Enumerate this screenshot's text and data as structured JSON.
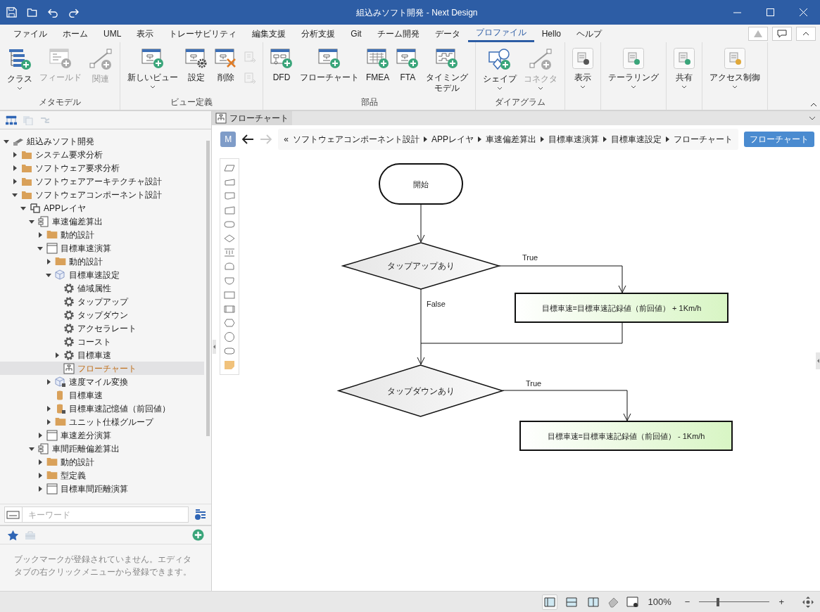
{
  "window": {
    "title": "組込みソフト開発 - Next Design"
  },
  "menu_tabs": [
    {
      "label": "ファイル",
      "selected": false
    },
    {
      "label": "ホーム",
      "selected": false
    },
    {
      "label": "UML",
      "selected": false
    },
    {
      "label": "表示",
      "selected": false
    },
    {
      "label": "トレーサビリティ",
      "selected": false
    },
    {
      "label": "編集支援",
      "selected": false
    },
    {
      "label": "分析支援",
      "selected": false
    },
    {
      "label": "Git",
      "selected": false
    },
    {
      "label": "チーム開発",
      "selected": false
    },
    {
      "label": "データ",
      "selected": false
    },
    {
      "label": "プロファイル",
      "selected": true
    },
    {
      "label": "Hello",
      "selected": false
    },
    {
      "label": "ヘルプ",
      "selected": false
    }
  ],
  "ribbon_groups": [
    {
      "label": "メタモデル",
      "buttons": [
        {
          "kind": "large",
          "label": "クラス",
          "dropdown": true,
          "disabled": false
        },
        {
          "kind": "large",
          "label": "フィールド",
          "dropdown": false,
          "disabled": true
        },
        {
          "kind": "large",
          "label": "関連",
          "dropdown": false,
          "disabled": true
        }
      ]
    },
    {
      "label": "ビュー定義",
      "buttons": [
        {
          "kind": "large",
          "label": "新しいビュー",
          "dropdown": true,
          "disabled": false
        },
        {
          "kind": "large",
          "label": "設定",
          "dropdown": false,
          "disabled": false
        },
        {
          "kind": "large",
          "label": "削除",
          "dropdown": false,
          "disabled": false
        },
        {
          "kind": "small",
          "disabled": true
        },
        {
          "kind": "small",
          "disabled": true
        }
      ]
    },
    {
      "label": "部品",
      "buttons": [
        {
          "kind": "large",
          "label": "DFD",
          "dropdown": false,
          "disabled": false
        },
        {
          "kind": "large",
          "label": "フローチャート",
          "dropdown": false,
          "disabled": false
        },
        {
          "kind": "large",
          "label": "FMEA",
          "dropdown": false,
          "disabled": false
        },
        {
          "kind": "large",
          "label": "FTA",
          "dropdown": false,
          "disabled": false
        },
        {
          "kind": "large",
          "label_lines": [
            "タイミング",
            "モデル"
          ],
          "dropdown": false,
          "disabled": false
        }
      ]
    },
    {
      "label": "ダイアグラム",
      "buttons": [
        {
          "kind": "large",
          "label": "シェイプ",
          "dropdown": true,
          "disabled": false
        },
        {
          "kind": "large",
          "label": "コネクタ",
          "dropdown": true,
          "disabled": true
        }
      ]
    },
    {
      "buttons": [
        {
          "kind": "large",
          "label": "表示",
          "dropdown": true,
          "disabled": false
        }
      ]
    },
    {
      "buttons": [
        {
          "kind": "large",
          "label": "テーラリング",
          "dropdown": true,
          "disabled": false
        }
      ]
    },
    {
      "buttons": [
        {
          "kind": "large",
          "label": "共有",
          "dropdown": true,
          "disabled": false
        }
      ]
    },
    {
      "buttons": [
        {
          "kind": "large",
          "label": "アクセス制御",
          "dropdown": true,
          "disabled": false
        }
      ]
    }
  ],
  "tree": [
    {
      "kind": "project",
      "label": "組込みソフト開発",
      "selected": false,
      "expanded": true,
      "children": [
        {
          "kind": "folder",
          "label": "システム要求分析",
          "selected": false,
          "expanded": false
        },
        {
          "kind": "folder",
          "label": "ソフトウェア要求分析",
          "selected": false,
          "expanded": false
        },
        {
          "kind": "folder",
          "label": "ソフトウェアアーキテクチャ設計",
          "selected": false,
          "expanded": false
        },
        {
          "kind": "folder",
          "label": "ソフトウェアコンポーネント設計",
          "selected": false,
          "expanded": true,
          "children": [
            {
              "kind": "layer",
              "label": "APPレイヤ",
              "selected": false,
              "expanded": true,
              "children": [
                {
                  "kind": "component",
                  "label": "車速偏差算出",
                  "selected": false,
                  "expanded": true,
                  "children": [
                    {
                      "kind": "package",
                      "label": "動的設計",
                      "selected": false,
                      "expanded": false
                    },
                    {
                      "kind": "class",
                      "label": "目標車速演算",
                      "selected": false,
                      "expanded": true,
                      "children": [
                        {
                          "kind": "package",
                          "label": "動的設計",
                          "selected": false,
                          "expanded": false
                        },
                        {
                          "kind": "cube",
                          "label": "目標車速設定",
                          "selected": false,
                          "expanded": true,
                          "children": [
                            {
                              "kind": "gear",
                              "label": "値域属性",
                              "selected": false
                            },
                            {
                              "kind": "gear",
                              "label": "タップアップ",
                              "selected": false
                            },
                            {
                              "kind": "gear",
                              "label": "タップダウン",
                              "selected": false
                            },
                            {
                              "kind": "gear",
                              "label": "アクセラレート",
                              "selected": false
                            },
                            {
                              "kind": "gear",
                              "label": "コースト",
                              "selected": false
                            },
                            {
                              "kind": "gear",
                              "label": "目標車速",
                              "selected": false,
                              "expanded": false
                            },
                            {
                              "kind": "flowchart",
                              "label": "フローチャート",
                              "selected": true
                            }
                          ]
                        },
                        {
                          "kind": "cube-locked",
                          "label": "速度マイル変換",
                          "selected": false,
                          "expanded": false
                        },
                        {
                          "kind": "cylinder",
                          "label": "目標車速",
                          "selected": false
                        },
                        {
                          "kind": "cylinder-locked",
                          "label": "目標車速記憶値（前回値）",
                          "selected": false,
                          "expanded": false
                        },
                        {
                          "kind": "package",
                          "label": "ユニット仕様グループ",
                          "selected": false,
                          "expanded": false
                        }
                      ]
                    },
                    {
                      "kind": "class",
                      "label": "車速差分演算",
                      "selected": false,
                      "expanded": false
                    }
                  ]
                },
                {
                  "kind": "component",
                  "label": "車間距離偏差算出",
                  "selected": false,
                  "expanded": true,
                  "children": [
                    {
                      "kind": "package",
                      "label": "動的設計",
                      "selected": false,
                      "expanded": false
                    },
                    {
                      "kind": "package",
                      "label": "型定義",
                      "selected": false,
                      "expanded": false
                    },
                    {
                      "kind": "class",
                      "label": "目標車間距離演算",
                      "selected": false,
                      "expanded": false
                    }
                  ]
                }
              ]
            }
          ]
        }
      ]
    }
  ],
  "search": {
    "placeholder": "キーワード"
  },
  "bookmarks": {
    "message": "ブックマークが登録されていません。エディタタブの右クリックメニューから登録できます。"
  },
  "editor_tab": {
    "label": "フローチャート"
  },
  "breadcrumb": {
    "mode": "M",
    "lead": "«",
    "items": [
      "ソフトウェアコンポーネント設計",
      "APPレイヤ",
      "車速偏差算出",
      "目標車速演算",
      "目標車速設定",
      "フローチャート"
    ]
  },
  "view_button": "フローチャート",
  "diagram": {
    "nodes": [
      {
        "kind": "terminal",
        "text": "開始"
      },
      {
        "kind": "decision",
        "text": "タップアップあり"
      },
      {
        "kind": "process",
        "text": "目標車速=目標車速記録値（前回値） + 1Km/h"
      },
      {
        "kind": "decision",
        "text": "タップダウンあり"
      },
      {
        "kind": "process",
        "text": "目標車速=目標車速記録値（前回値） - 1Km/h"
      }
    ],
    "edge_labels": [
      "True",
      "False",
      "True"
    ]
  },
  "status_bar": {
    "layouts": [
      {
        "selected": true
      },
      {
        "selected": false
      },
      {
        "selected": false
      }
    ],
    "zoom": "100%",
    "minus": "−",
    "plus": "+",
    "zoom_slider": {
      "level": 0.27
    }
  }
}
